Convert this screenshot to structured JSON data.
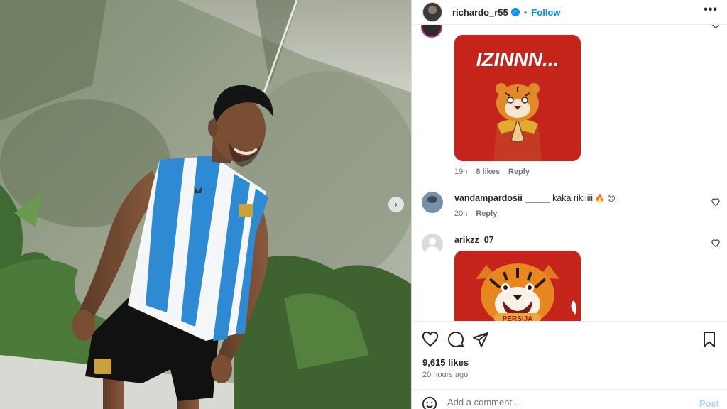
{
  "post": {
    "username": "richardo_r55",
    "separator": "•",
    "follow_label": "Follow",
    "more_label": "•••"
  },
  "comments": [
    {
      "id": "partial",
      "sticker_text": "IZINNN...",
      "time": "19h",
      "likes": "8 likes",
      "reply_label": "Reply"
    },
    {
      "id": "vandam",
      "username": "vandampardosii",
      "text": "_____ kaka rikiiiii",
      "emojis": "🔥 😍",
      "time": "20h",
      "reply_label": "Reply"
    },
    {
      "id": "arikzz",
      "username": "arikzz_07",
      "sticker_text": "PERSIJA"
    }
  ],
  "footer": {
    "likes": "9,615 likes",
    "time_ago": "20 hours ago",
    "comment_placeholder": "Add a comment...",
    "post_label": "Post"
  },
  "colors": {
    "accent": "#0095f6",
    "sticker_red": "#c4241a",
    "jersey_blue": "#2e8bd3"
  },
  "icons": [
    "heart-icon",
    "comment-icon",
    "share-icon",
    "bookmark-icon",
    "emoji-icon",
    "chevron-right-icon",
    "verified-icon"
  ]
}
